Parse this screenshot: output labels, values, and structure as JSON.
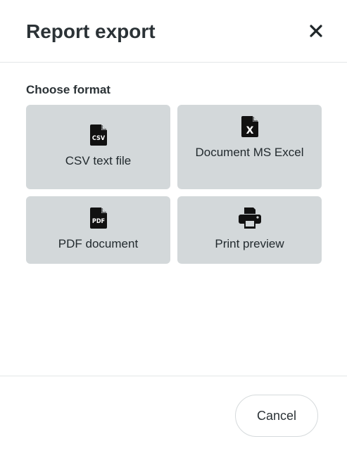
{
  "dialog": {
    "title": "Report export",
    "close_icon": "close-icon"
  },
  "section": {
    "label": "Choose format"
  },
  "formats": [
    {
      "label": "CSV text file",
      "icon": "csv-file-icon",
      "icon_text": "CSV"
    },
    {
      "label": "Document MS Excel",
      "icon": "excel-file-icon",
      "icon_text": "X"
    },
    {
      "label": "PDF document",
      "icon": "pdf-file-icon",
      "icon_text": "PDF"
    },
    {
      "label": "Print preview",
      "icon": "printer-icon"
    }
  ],
  "footer": {
    "cancel_label": "Cancel"
  },
  "colors": {
    "tile_background": "#d3d8da",
    "text": "#2b3236",
    "divider": "#e3e6e8"
  }
}
